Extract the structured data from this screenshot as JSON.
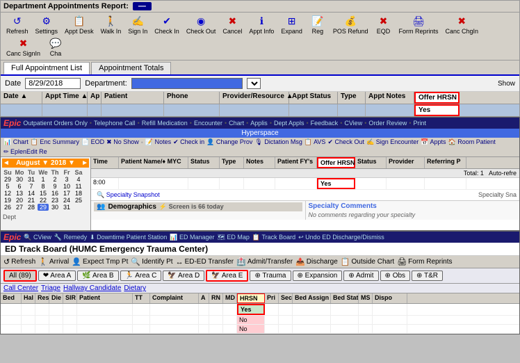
{
  "section1": {
    "title": "Department Appointments Report:",
    "title_badge": "—",
    "toolbar": {
      "buttons": [
        {
          "label": "Refresh",
          "icon": "↺",
          "color": "blue"
        },
        {
          "label": "Settings",
          "icon": "⚙",
          "color": "blue"
        },
        {
          "label": "Appt Desk",
          "icon": "📋",
          "color": "blue"
        },
        {
          "label": "Walk In",
          "icon": "🚶",
          "color": "blue"
        },
        {
          "label": "Sign In",
          "icon": "✍",
          "color": "blue"
        },
        {
          "label": "Check In",
          "icon": "✔",
          "color": "blue"
        },
        {
          "label": "Check Out",
          "icon": "◉",
          "color": "blue"
        },
        {
          "label": "Cancel",
          "icon": "✖",
          "color": "red"
        },
        {
          "label": "Appt Info",
          "icon": "ℹ",
          "color": "blue"
        },
        {
          "label": "Expand",
          "icon": "⊞",
          "color": "blue"
        },
        {
          "label": "Reg",
          "icon": "📝",
          "color": "blue"
        },
        {
          "label": "POS Refund",
          "icon": "💰",
          "color": "blue"
        },
        {
          "label": "EQD",
          "icon": "✖",
          "color": "red"
        },
        {
          "label": "Form Reprints",
          "icon": "🖨",
          "color": "blue"
        },
        {
          "label": "Canc ChgIn",
          "icon": "✖",
          "color": "red"
        },
        {
          "label": "Canc SignIn",
          "icon": "✖",
          "color": "red"
        },
        {
          "label": "Cha",
          "icon": "💬",
          "color": "blue"
        }
      ]
    },
    "tabs": [
      {
        "label": "Full Appointment List",
        "active": true
      },
      {
        "label": "Appointment Totals",
        "active": false
      }
    ],
    "filter": {
      "date_label": "Date",
      "date_value": "8/29/2018",
      "dept_label": "Department:",
      "show_label": "Show"
    },
    "grid": {
      "headers": [
        "Date ▲",
        "Appt Time ▲",
        "Ap",
        "Patient",
        "Phone",
        "Provider/Resource ▲",
        "Appt Status",
        "Type",
        "Appt Notes",
        "Offer HRSN"
      ],
      "rows": [
        {
          "cells": [
            "",
            "",
            "",
            "",
            "",
            "",
            "",
            "",
            "",
            "Yes"
          ]
        }
      ]
    }
  },
  "section2": {
    "hyperspace_label": "Hyperspace",
    "epic_nav_items": [
      "Outpatient Orders Only",
      "Telephone Call",
      "Refill Medication",
      "Encounter",
      "Chart",
      "Applis",
      "Dept Appls",
      "Feedback",
      "CView",
      "Order Review",
      "Print"
    ],
    "sub_toolbar_items": [
      "Chart",
      "Enc Summary",
      "EOD",
      "No Show",
      "Notes",
      "Check in",
      "Change Prov",
      "Dictation Msg",
      "AVS",
      "Check Out",
      "Sign Encounter",
      "Appts",
      "Room Patient",
      "EplenEdit Re"
    ],
    "schedule_date": "8/29/2018",
    "calendar": {
      "month": "August",
      "year": "2018",
      "days_header": [
        "Su",
        "Mo",
        "Tu",
        "We",
        "Th",
        "Fr",
        "Sa"
      ],
      "weeks": [
        [
          "29",
          "30",
          "31",
          "1",
          "2",
          "3",
          "4"
        ],
        [
          "5",
          "6",
          "7",
          "8",
          "9",
          "10",
          "11"
        ],
        [
          "12",
          "13",
          "14",
          "15",
          "16",
          "17",
          "18"
        ],
        [
          "19",
          "20",
          "21",
          "22",
          "23",
          "24",
          "25"
        ],
        [
          "26",
          "27",
          "28",
          "29",
          "30",
          "31",
          ""
        ]
      ],
      "today": "29",
      "selected": "29"
    },
    "dept_label": "Dept",
    "grid": {
      "headers": [
        "Time",
        "Patient Name/♦ MYC",
        "Status",
        "Type",
        "Notes",
        "Patient FY's",
        "Offer HRSN",
        "Status",
        "Provider",
        "Referring P"
      ],
      "total_label": "Total: 1",
      "auto_refresh": "Auto-refre",
      "rows": [
        {
          "time": "8:00",
          "patient": "",
          "status": "",
          "type": "",
          "notes": "",
          "fy": "",
          "offer_hrsn": "Yes",
          "status2": "",
          "provider": "",
          "referring": ""
        }
      ]
    },
    "specialty_snapshot": "Specialty Snapshot",
    "specialty_snap_right": "Specialty Sna",
    "demographics": {
      "title": "Demographics",
      "screen_info": "Screen is 66 today"
    },
    "specialty_comments": {
      "title": "Specialty Comments",
      "text": "No comments regarding your specialty"
    }
  },
  "section3": {
    "epic_nav_items": [
      "CView",
      "Remedy",
      "Downtime Patient Station",
      "ED Manager",
      "ED Map",
      "Track Board",
      "Undo ED Discharge/Dismiss"
    ],
    "ed_title": "ED Track Board (HUMC Emergency Trauma Center)",
    "ed_toolbar": [
      {
        "label": "Refresh",
        "icon": "↺"
      },
      {
        "label": "Arrival",
        "icon": "🚶"
      },
      {
        "label": "Expect Tmp Pt",
        "icon": "👤"
      },
      {
        "label": "Identify Pt",
        "icon": "🔍"
      },
      {
        "label": "ED-ED Transfer",
        "icon": "↔"
      },
      {
        "label": "Admit/Transfer",
        "icon": "🏥"
      },
      {
        "label": "Discharge",
        "icon": "📤"
      },
      {
        "label": "Outside Chart",
        "icon": "📋"
      },
      {
        "label": "Form Reprints",
        "icon": "🖨"
      }
    ],
    "area_tabs": [
      {
        "label": "All (89)",
        "active": true,
        "icon": ""
      },
      {
        "label": "Area A",
        "icon": "❤"
      },
      {
        "label": "Area B",
        "icon": "🌿"
      },
      {
        "label": "Area C",
        "icon": "🏃"
      },
      {
        "label": "Area D",
        "icon": "🦅"
      },
      {
        "label": "Area E",
        "icon": "🦅"
      },
      {
        "label": "Trauma",
        "icon": "⊕"
      },
      {
        "label": "Expansion",
        "icon": "⊕"
      },
      {
        "label": "Admit",
        "icon": "⊕"
      },
      {
        "label": "Obs",
        "icon": "⊕"
      },
      {
        "label": "T&R",
        "icon": "⊕"
      }
    ],
    "sub_tabs": [
      "Call Center",
      "Triage",
      "Hallway Candidate",
      "Dietary"
    ],
    "grid": {
      "headers": [
        "Bed",
        "Hal",
        "Res",
        "Die",
        "SIR",
        "Patient",
        "TT",
        "Complaint",
        "A",
        "RN",
        "MD",
        "HRSN",
        "Pri",
        "Sec",
        "Bed Assign",
        "Bed Stat",
        "MS",
        "Dispo"
      ],
      "rows": [
        {
          "hrsn": "Yes"
        },
        {
          "hrsn": "No"
        },
        {
          "hrsn": "No"
        }
      ]
    }
  }
}
